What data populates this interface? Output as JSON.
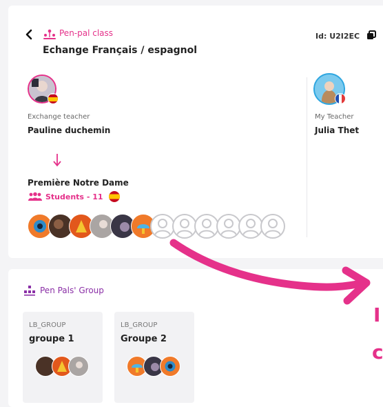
{
  "class": {
    "label": "Pen-pal class",
    "title": "Echange Français / espagnol",
    "id_text": "Id: U2I2EC"
  },
  "exchange_teacher": {
    "role": "Exchange teacher",
    "name": "Pauline duchemin",
    "school": "Première Notre Dame",
    "students_label": "Students - 11"
  },
  "my_teacher": {
    "role": "My Teacher",
    "name": "Julia Thet"
  },
  "pen_pals_group": {
    "title": "Pen Pals' Group",
    "groups": [
      {
        "code": "LB_GROUP",
        "name": "groupe 1"
      },
      {
        "code": "LB_GROUP",
        "name": "Groupe 2"
      }
    ]
  },
  "overlay_text": {
    "line1": "I",
    "line2": "c"
  },
  "colors": {
    "accent_pink": "#e5318a",
    "accent_purple": "#8a2fa6",
    "card_bg": "#ffffff",
    "page_bg": "#f4f4f6"
  },
  "icons": [
    "chevron-left-icon",
    "pen-pal-class-icon",
    "copy-icon",
    "arrow-down-icon",
    "students-icon",
    "spain-flag-icon",
    "france-flag-icon",
    "pen-pals-group-icon"
  ]
}
